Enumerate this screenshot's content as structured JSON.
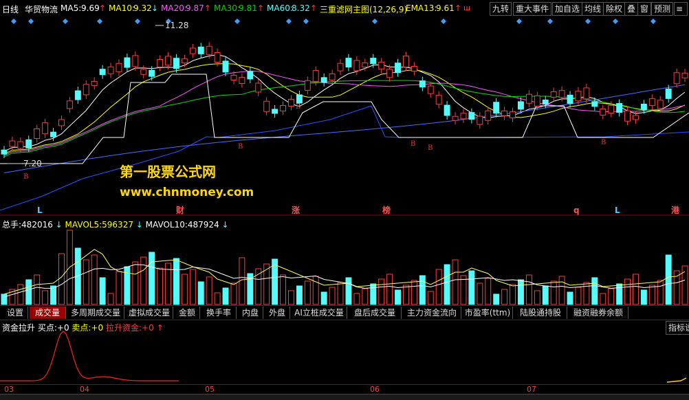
{
  "topbar": {
    "period": "日线",
    "stock": "华贸物流",
    "ma5_label": "MA5:",
    "ma5": "9.69",
    "ma10_label": "MA10:",
    "ma10": "9.32",
    "ma20_label": "MA20:",
    "ma20": "9.87",
    "ma30_label": "MA30:",
    "ma30": "9.81",
    "ma60_label": "MA60:",
    "ma60": "8.32",
    "indicator": "三重滤网主图(12,26,9)",
    "ema13_label": "EMA13:",
    "ema13": "9.61",
    "buttons": [
      "九转",
      "重大事件",
      "加自选",
      "均线",
      "除权",
      "叠",
      "窗",
      "预测"
    ]
  },
  "main": {
    "high_label": "11.28",
    "low_label": "7.20",
    "markers": [
      "L",
      "财",
      "涨",
      "榜",
      "q",
      "L",
      "港"
    ],
    "buy_sign": "B"
  },
  "watermark": {
    "line1": "第一股票公式网",
    "line2": "www.chnmoney.com"
  },
  "volume": {
    "title": "总手:",
    "value": "482016",
    "mavol5_label": "MAVOL5:",
    "mavol5": "596327",
    "mavol10_label": "MAVOL10:",
    "mavol10": "487924"
  },
  "tabs": [
    "设置",
    "成交量",
    "多周期成交量",
    "虚拟成交量",
    "金额",
    "换手率",
    "内盘",
    "外盘",
    "AI立桩成交量",
    "盘后成交量",
    "主力资金流向",
    "市盈率(ttm)",
    "陆股通持股",
    "融资融券余额"
  ],
  "indicator_panel": {
    "title": "资金拉升",
    "buy_label": "买点:",
    "buy_value": "+0",
    "sell_label": "卖点:",
    "sell_value": "+0",
    "lift_label": "拉升资金:",
    "lift_value": "+0",
    "button": "指标说"
  },
  "axis": [
    "03",
    "04",
    "05",
    "06",
    "07"
  ],
  "colors": {
    "up": "#ff3c3c",
    "down": "#54fcfc",
    "ma5": "#ffffff",
    "ma10": "#ffff00",
    "ma20": "#ff55ff",
    "ma30": "#00e000",
    "ma60": "#4a6cff"
  }
}
